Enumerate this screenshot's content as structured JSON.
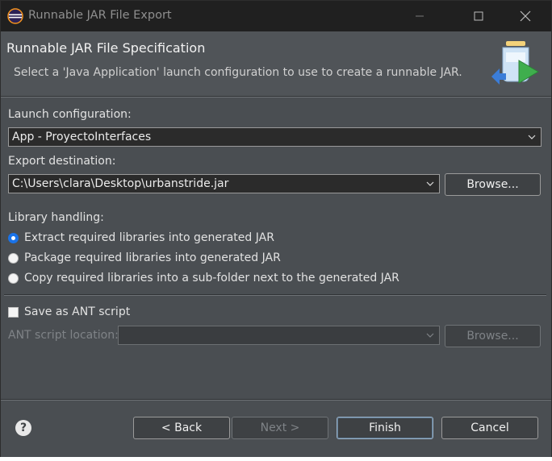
{
  "window": {
    "title": "Runnable JAR File Export",
    "controls": {
      "minimize_icon": "minimize-icon",
      "maximize_icon": "maximize-icon",
      "close_icon": "close-icon"
    }
  },
  "header": {
    "title": "Runnable JAR File Specification",
    "description": "Select a 'Java Application' launch configuration to use to create a runnable JAR.",
    "image_icon": "jar-export-wizard-icon"
  },
  "launch": {
    "label": "Launch configuration:",
    "value": "App - ProyectoInterfaces"
  },
  "export": {
    "label": "Export destination:",
    "value": "C:\\Users\\clara\\Desktop\\urbanstride.jar",
    "browse": "Browse..."
  },
  "library": {
    "label": "Library handling:",
    "options": [
      {
        "label": "Extract required libraries into generated JAR",
        "selected": true
      },
      {
        "label": "Package required libraries into generated JAR",
        "selected": false
      },
      {
        "label": "Copy required libraries into a sub-folder next to the generated JAR",
        "selected": false
      }
    ]
  },
  "ant": {
    "save_label": "Save as ANT script",
    "checked": false,
    "location_label": "ANT script location:",
    "location_value": "",
    "browse": "Browse..."
  },
  "footer": {
    "help_icon": "help-icon",
    "back": "< Back",
    "next": "Next >",
    "finish": "Finish",
    "cancel": "Cancel"
  },
  "colors": {
    "dialog_bg": "#4a4e52",
    "titlebar_bg": "#202020",
    "radio_selected": "#1a73e8"
  }
}
